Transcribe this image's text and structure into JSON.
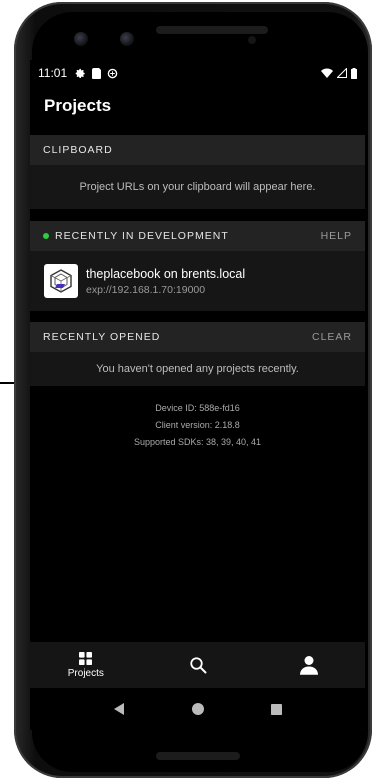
{
  "status_bar": {
    "time": "11:01"
  },
  "header": {
    "title": "Projects"
  },
  "clipboard": {
    "title": "CLIPBOARD",
    "empty_text": "Project URLs on your clipboard will appear here."
  },
  "recent_dev": {
    "title": "RECENTLY IN DEVELOPMENT",
    "action": "HELP",
    "indicator_color": "#2ecc40",
    "project": {
      "name": "theplacebook on brents.local",
      "url": "exp://192.168.1.70:19000"
    }
  },
  "recent_opened": {
    "title": "RECENTLY OPENED",
    "action": "CLEAR",
    "empty_text": "You haven't opened any projects recently."
  },
  "device": {
    "id": "Device ID: 588e-fd16",
    "client_version": "Client version: 2.18.8",
    "sdks": "Supported SDKs: 38, 39, 40, 41"
  },
  "bottom_nav": {
    "projects_label": "Projects",
    "items": [
      "grid-icon",
      "search-icon",
      "profile-icon"
    ]
  },
  "colors": {
    "background": "#000000",
    "section_header": "#232323",
    "section_body": "#161616",
    "accent_green": "#2ecc40"
  }
}
